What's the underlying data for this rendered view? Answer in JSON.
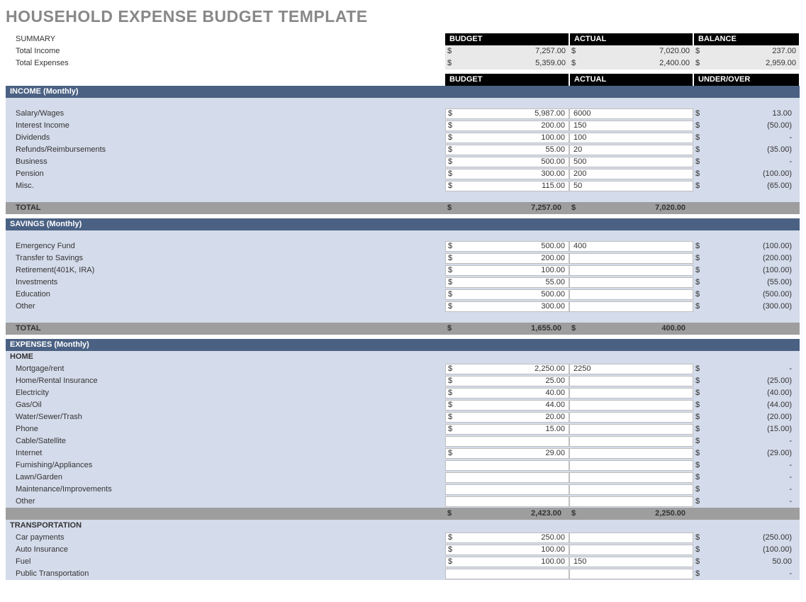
{
  "title": "HOUSEHOLD EXPENSE BUDGET TEMPLATE",
  "summary": {
    "heading": "SUMMARY",
    "cols": {
      "budget": "BUDGET",
      "actual": "ACTUAL",
      "balance": "BALANCE"
    },
    "rows": [
      {
        "label": "Total Income",
        "budget": "7,257.00",
        "actual": "7,020.00",
        "balance": "237.00"
      },
      {
        "label": "Total Expenses",
        "budget": "5,359.00",
        "actual": "2,400.00",
        "balance": "2,959.00"
      }
    ]
  },
  "cols2": {
    "budget": "BUDGET",
    "actual": "ACTUAL",
    "uo": "UNDER/OVER"
  },
  "cur": "$",
  "income": {
    "title": "INCOME (Monthly)",
    "rows": [
      {
        "label": "Salary/Wages",
        "budget": "5,987.00",
        "actual": "6000",
        "uo": "13.00"
      },
      {
        "label": "Interest Income",
        "budget": "200.00",
        "actual": "150",
        "uo": "(50.00)"
      },
      {
        "label": "Dividends",
        "budget": "100.00",
        "actual": "100",
        "uo": "-"
      },
      {
        "label": "Refunds/Reimbursements",
        "budget": "55.00",
        "actual": "20",
        "uo": "(35.00)"
      },
      {
        "label": "Business",
        "budget": "500.00",
        "actual": "500",
        "uo": "-"
      },
      {
        "label": "Pension",
        "budget": "300.00",
        "actual": "200",
        "uo": "(100.00)"
      },
      {
        "label": "Misc.",
        "budget": "115.00",
        "actual": "50",
        "uo": "(65.00)"
      }
    ],
    "total": {
      "label": "TOTAL",
      "budget": "7,257.00",
      "actual": "7,020.00"
    }
  },
  "savings": {
    "title": "SAVINGS (Monthly)",
    "rows": [
      {
        "label": "Emergency Fund",
        "budget": "500.00",
        "actual": "400",
        "uo": "(100.00)"
      },
      {
        "label": "Transfer to Savings",
        "budget": "200.00",
        "actual": "",
        "uo": "(200.00)"
      },
      {
        "label": "Retirement(401K, IRA)",
        "budget": "100.00",
        "actual": "",
        "uo": "(100.00)"
      },
      {
        "label": "Investments",
        "budget": "55.00",
        "actual": "",
        "uo": "(55.00)"
      },
      {
        "label": "Education",
        "budget": "500.00",
        "actual": "",
        "uo": "(500.00)"
      },
      {
        "label": "Other",
        "budget": "300.00",
        "actual": "",
        "uo": "(300.00)"
      }
    ],
    "total": {
      "label": "TOTAL",
      "budget": "1,655.00",
      "actual": "400.00"
    }
  },
  "expenses": {
    "title": "EXPENSES (Monthly)",
    "cats": [
      {
        "name": "HOME",
        "rows": [
          {
            "label": "Mortgage/rent",
            "budget": "2,250.00",
            "actual": "2250",
            "uo": "-"
          },
          {
            "label": "Home/Rental Insurance",
            "budget": "25.00",
            "actual": "",
            "uo": "(25.00)"
          },
          {
            "label": "Electricity",
            "budget": "40.00",
            "actual": "",
            "uo": "(40.00)"
          },
          {
            "label": "Gas/Oil",
            "budget": "44.00",
            "actual": "",
            "uo": "(44.00)"
          },
          {
            "label": "Water/Sewer/Trash",
            "budget": "20.00",
            "actual": "",
            "uo": "(20.00)"
          },
          {
            "label": "Phone",
            "budget": "15.00",
            "actual": "",
            "uo": "(15.00)"
          },
          {
            "label": "Cable/Satellite",
            "budget": "",
            "actual": "",
            "uo": "-"
          },
          {
            "label": "Internet",
            "budget": "29.00",
            "actual": "",
            "uo": "(29.00)"
          },
          {
            "label": "Furnishing/Appliances",
            "budget": "",
            "actual": "",
            "uo": "-"
          },
          {
            "label": "Lawn/Garden",
            "budget": "",
            "actual": "",
            "uo": "-"
          },
          {
            "label": "Maintenance/Improvements",
            "budget": "",
            "actual": "",
            "uo": "-"
          },
          {
            "label": "Other",
            "budget": "",
            "actual": "",
            "uo": "-"
          }
        ],
        "sub": {
          "budget": "2,423.00",
          "actual": "2,250.00"
        }
      },
      {
        "name": "TRANSPORTATION",
        "rows": [
          {
            "label": "Car payments",
            "budget": "250.00",
            "actual": "",
            "uo": "(250.00)"
          },
          {
            "label": "Auto Insurance",
            "budget": "100.00",
            "actual": "",
            "uo": "(100.00)"
          },
          {
            "label": "Fuel",
            "budget": "100.00",
            "actual": "150",
            "uo": "50.00"
          },
          {
            "label": "Public Transportation",
            "budget": "",
            "actual": "",
            "uo": "-"
          }
        ]
      }
    ]
  }
}
